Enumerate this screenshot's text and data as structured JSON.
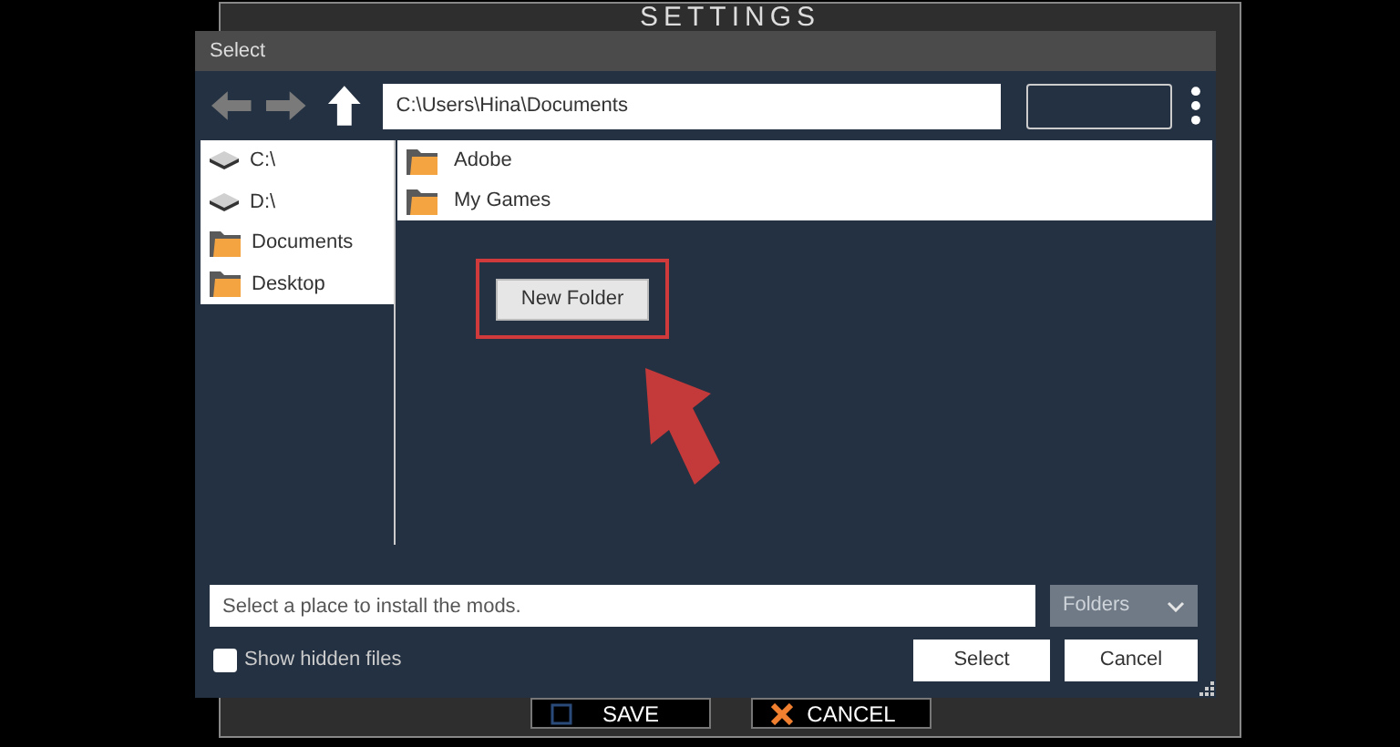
{
  "background_window": {
    "title": "SETTINGS",
    "buttons": [
      {
        "label": "SAVE",
        "kind": "save"
      },
      {
        "label": "CANCEL",
        "kind": "cancel"
      }
    ]
  },
  "dialog": {
    "title": "Select",
    "path": "C:\\Users\\Hina\\Documents",
    "places": [
      {
        "label": "C:\\",
        "kind": "drive"
      },
      {
        "label": "D:\\",
        "kind": "drive"
      },
      {
        "label": "Documents",
        "kind": "folder"
      },
      {
        "label": "Desktop",
        "kind": "folder"
      }
    ],
    "entries": [
      {
        "label": "Adobe"
      },
      {
        "label": "My Games"
      }
    ],
    "new_folder_button": {
      "label": "New Folder",
      "highlighted": true
    },
    "filename": {
      "placeholder": "Select a place to install the mods."
    },
    "filter": "Folders",
    "show_hidden": {
      "label": "Show hidden files",
      "checked": false
    },
    "buttons": [
      "Select",
      "Cancel"
    ]
  }
}
